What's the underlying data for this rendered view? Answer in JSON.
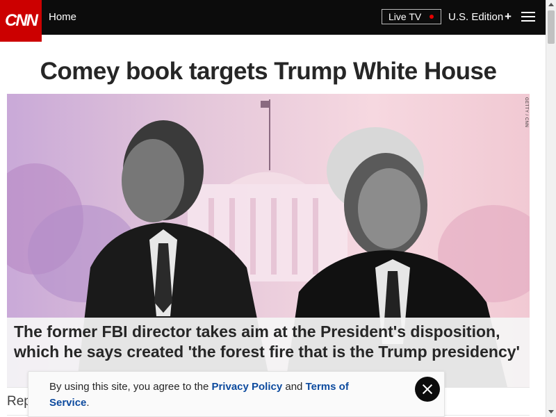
{
  "header": {
    "logo": "CNN",
    "home_label": "Home",
    "live_tv_label": "Live TV",
    "edition_label": "U.S. Edition",
    "edition_plus": "+"
  },
  "article": {
    "headline": "Comey book targets Trump White House",
    "photo_credit": "GETTY / CNN",
    "caption": "The former FBI director takes aim at the President's disposition, which he says created 'the forest fire that is the Trump presidency'",
    "byline_partial": "Rep"
  },
  "consent": {
    "text_before": "By using this site, you agree to the ",
    "privacy_label": "Privacy Policy",
    "and_text": " and ",
    "terms_label": "Terms of Service",
    "period": "."
  },
  "colors": {
    "brand_red": "#cc0000",
    "header_bg": "#0c0c0c",
    "live_dot": "#e60000",
    "link_blue": "#0c4a9e"
  }
}
